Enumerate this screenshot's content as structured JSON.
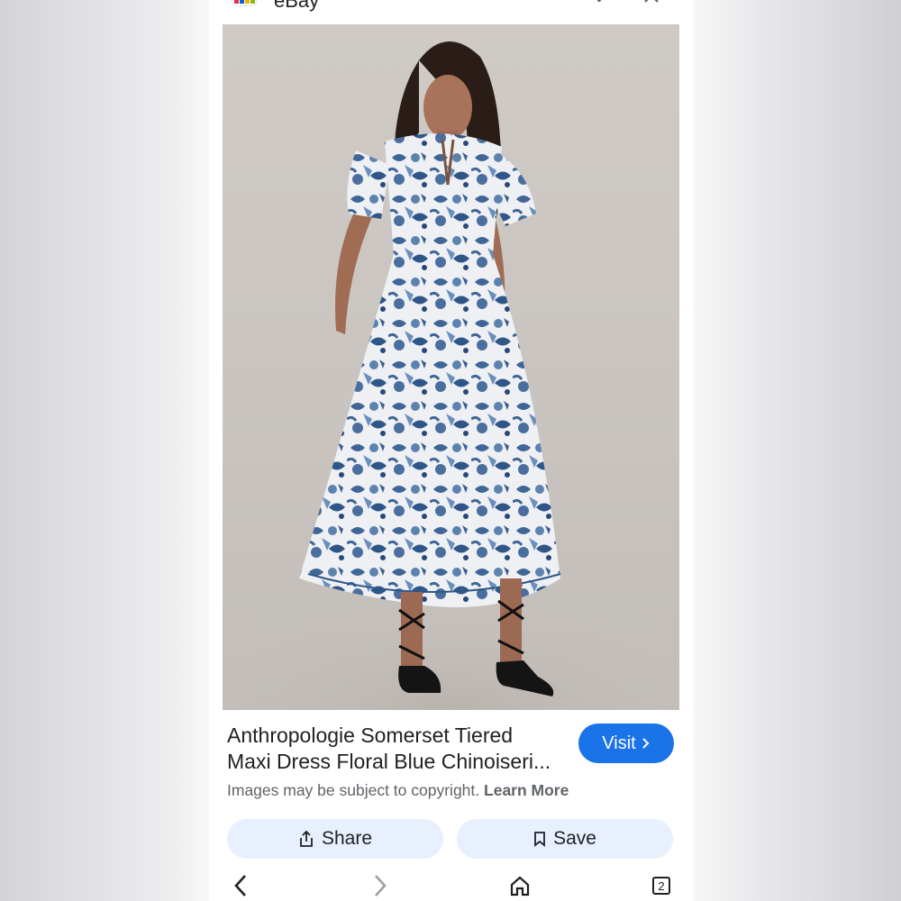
{
  "site": {
    "name": "eBay",
    "logo_icon": "ebay-favicon-icon"
  },
  "result": {
    "title_line1": "Anthropologie Somerset Tiered",
    "title_line2": "Maxi Dress Floral Blue Chinoiseri...",
    "image_alt": "Model wearing blue and white floral tiered maxi dress with black lace-up heels",
    "visit_label": "Visit",
    "copyright_text": "Images may be subject to copyright.",
    "learn_more_label": "Learn More"
  },
  "actions": {
    "share_label": "Share",
    "save_label": "Save"
  },
  "navbar": {
    "tab_count": "2"
  },
  "colors": {
    "accent": "#1a73e8",
    "action_bg": "#e8f0fe",
    "dress_blue": "#3f6696"
  }
}
